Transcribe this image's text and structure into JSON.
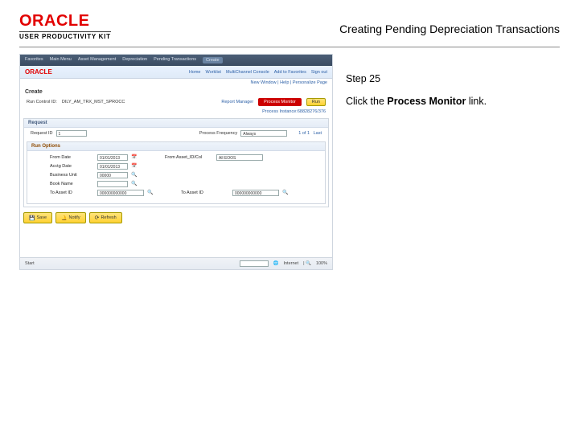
{
  "header": {
    "logo_main": "ORACLE",
    "logo_sub": "USER PRODUCTIVITY KIT",
    "page_title": "Creating Pending Depreciation Transactions"
  },
  "instruction": {
    "step_label": "Step 25",
    "text_before": "Click the ",
    "link_text": "Process Monitor",
    "text_after": " link."
  },
  "mini": {
    "tabs": [
      "Favorites",
      "Main Menu",
      "Asset Management",
      "Depreciation",
      "Pending Transactions",
      "Create"
    ],
    "brand": "ORACLE",
    "right_links": [
      "Home",
      "Worklist",
      "MultiChannel Console",
      "Add to Favorites",
      "Sign out"
    ],
    "newwin": "New Window | Help | Personalize Page",
    "subhead": "Create",
    "run_label": "Run Control ID:",
    "run_value": "DILY_AM_TRX_MST_SPROCC",
    "report_label": "Report Manager",
    "pm_label": "Process Monitor",
    "run_btn": "Run",
    "process_instance": "Process Instance:68828276/376",
    "request_hd": "Request",
    "bunit_label": "Request ID",
    "bunit_value": "1",
    "freq_label": "Process Frequency",
    "freq_value": "Always",
    "run_options_hd": "Run Options",
    "form": {
      "r1a": "From Date",
      "r1a_v": "01/01/2013",
      "r1b": "From Asset_ID/Col",
      "r1b_v": "All EOOS",
      "r2a": "Acctg Date",
      "r2a_v": "01/01/2013",
      "r3a": "Business Unit",
      "r3a_v": "00000",
      "r4a": "Book Name",
      "r5a": "To Asset ID",
      "r5a_v": "000000000000",
      "r5b": "To Asset ID",
      "r5b_v": "000000000000"
    },
    "actions": {
      "save": "Save",
      "notify": "Notify",
      "refresh": "Refresh"
    },
    "footer": {
      "start": "Start",
      "internet": "Internet",
      "zoom": "100%"
    }
  }
}
